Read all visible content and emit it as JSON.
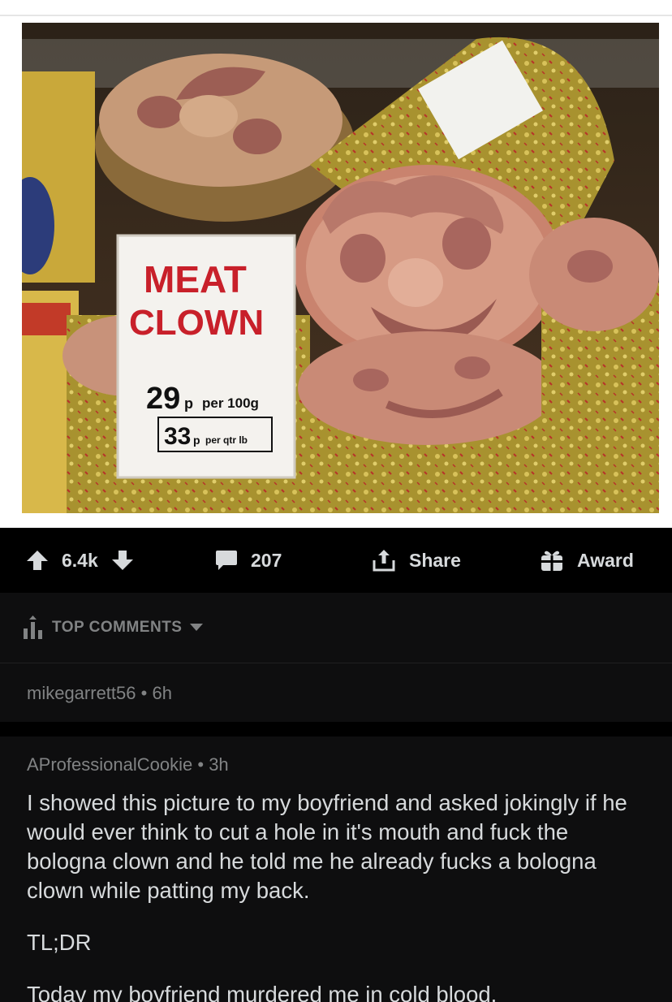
{
  "photo": {
    "sign_title_line1": "MEAT",
    "sign_title_line2": "CLOWN",
    "sign_price1": "29",
    "sign_price1_unit": "p",
    "sign_price1_label": "per 100g",
    "sign_price2": "33",
    "sign_price2_unit": "p",
    "sign_price2_label": "per qtr lb"
  },
  "actions": {
    "upvotes": "6.4k",
    "comments": "207",
    "share": "Share",
    "award": "Award"
  },
  "sort": {
    "label": "TOP COMMENTS"
  },
  "collapsed_comment": {
    "author": "mikegarrett56",
    "dot": "•",
    "age": "6h"
  },
  "comment": {
    "author": "AProfessionalCookie",
    "dot": "•",
    "age": "3h",
    "paragraphs": [
      "I showed this picture to my boyfriend and asked jokingly if he would ever think to cut a hole in it's mouth and fuck the bologna clown and he told me he already fucks a bologna clown while patting my back.",
      "TL;DR",
      "Today my boyfriend murdered me in cold blood."
    ]
  },
  "colors": {
    "background": "#000000",
    "card": "#0e0e0f",
    "text_primary": "#d7dadc",
    "text_meta": "#818384",
    "sign_red": "#c8202a"
  },
  "icons": {
    "upvote": "upvote-arrow-icon",
    "downvote": "downvote-arrow-icon",
    "comments": "comment-bubble-icon",
    "share": "share-upload-icon",
    "award": "gift-award-icon",
    "sort": "sort-bars-icon",
    "dropdown": "caret-down-icon"
  }
}
